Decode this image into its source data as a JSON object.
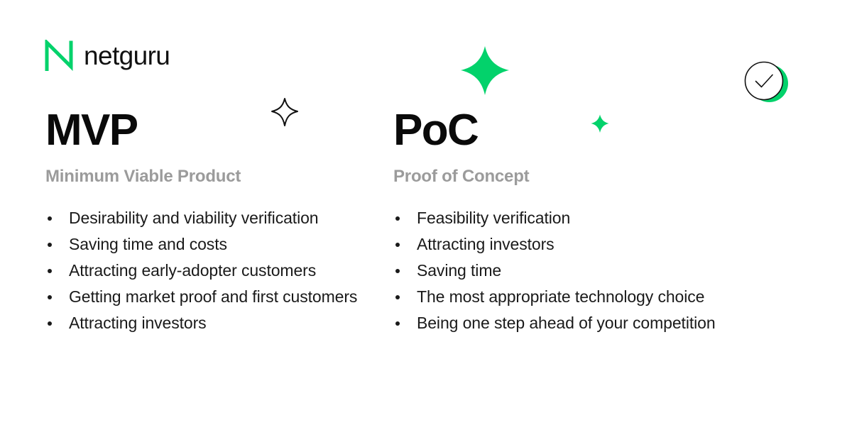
{
  "brand": {
    "logo_mark": "netguru-n-mark-icon",
    "wordmark": "netguru",
    "accent_color": "#03d26b",
    "text_color": "#0a0a0a",
    "muted_color": "#9b9b9b",
    "background_color": "#ffffff"
  },
  "columns": [
    {
      "key": "mvp",
      "title": "MVP",
      "subtitle": "Minimum Viable Product",
      "bullets": [
        "Desirability and viability verification",
        "Saving time and costs",
        "Attracting early-adopter customers",
        "Getting market proof and first customers",
        "Attracting investors"
      ]
    },
    {
      "key": "poc",
      "title": "PoC",
      "subtitle": "Proof of Concept",
      "bullets": [
        "Feasibility verification",
        "Attracting investors",
        "Saving time",
        "The most appropriate technology choice",
        "Being one step ahead of your competition"
      ]
    }
  ],
  "decorations": {
    "star_outline": "four-point-star-outline-icon",
    "star_green_large": "four-point-star-filled-icon",
    "star_green_small": "four-point-star-filled-icon",
    "check_badge": "check-circle-icon"
  }
}
